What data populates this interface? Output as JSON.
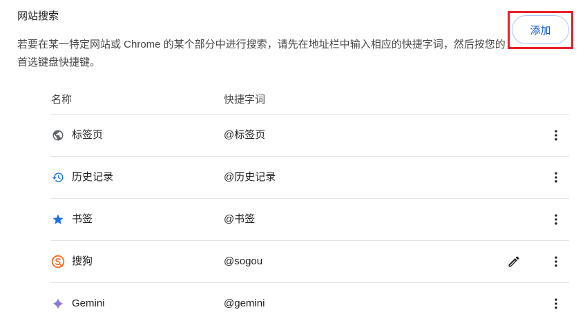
{
  "section": {
    "title": "网站搜索",
    "description": "若要在某一特定网站或 Chrome 的某个部分中进行搜索，请先在地址栏中输入相应的快捷字词，然后按您的首选键盘快捷键。",
    "add_label": "添加"
  },
  "table": {
    "headers": {
      "name": "名称",
      "keyword": "快捷字词"
    },
    "rows": [
      {
        "name": "标签页",
        "keyword": "@标签页",
        "icon": "globe-icon"
      },
      {
        "name": "历史记录",
        "keyword": "@历史记录",
        "icon": "history-icon"
      },
      {
        "name": "书签",
        "keyword": "@书签",
        "icon": "star-icon"
      },
      {
        "name": "搜狗",
        "keyword": "@sogou",
        "icon": "sogou-icon"
      },
      {
        "name": "Gemini",
        "keyword": "@gemini",
        "icon": "gemini-icon"
      }
    ]
  },
  "colors": {
    "accent": "#0b57d0",
    "highlight": "#e8202a",
    "sogou": "#fa6a1f"
  }
}
